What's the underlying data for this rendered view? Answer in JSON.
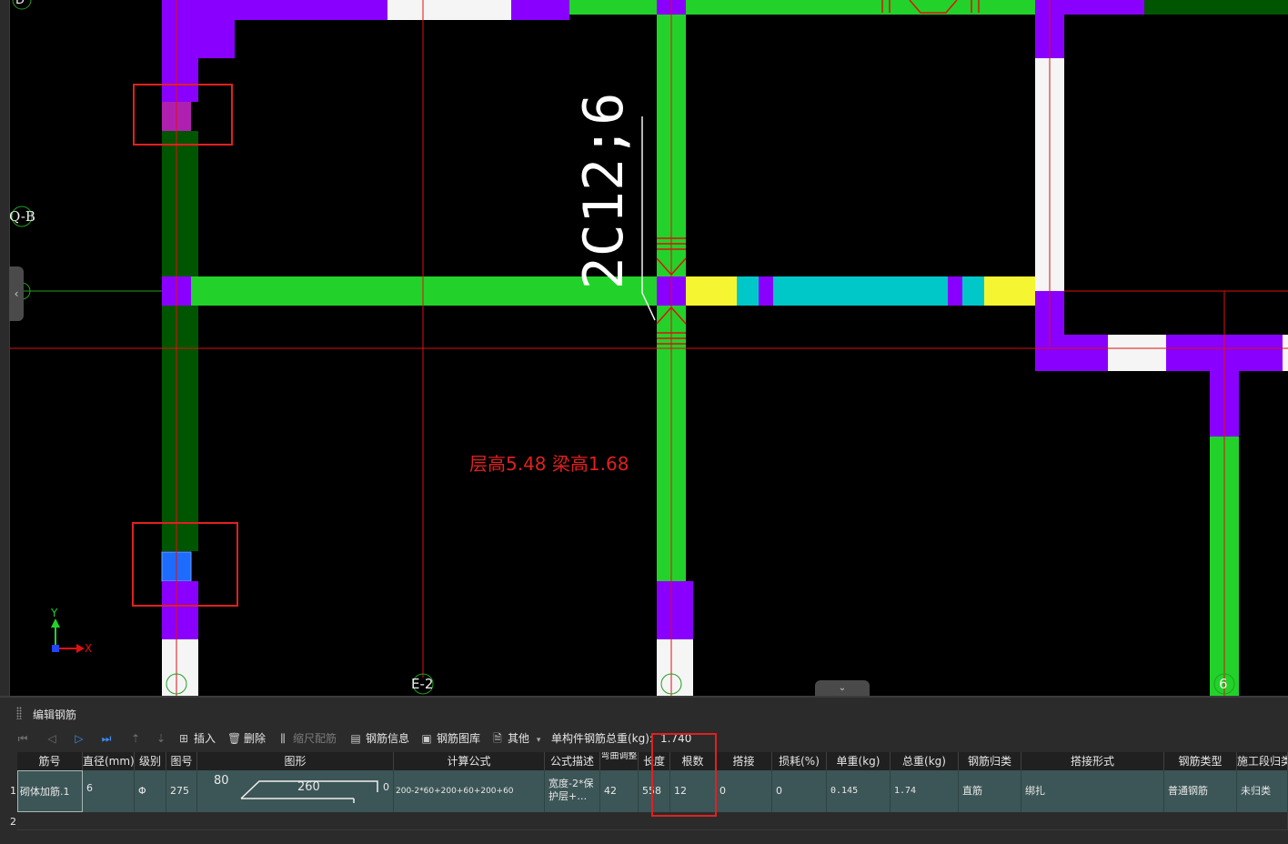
{
  "canvas": {
    "axis_labels": {
      "top_left": "D",
      "q_b": "Q-B",
      "e_2": "E-2",
      "six": "6"
    },
    "rebar_annotation": "2C12;6",
    "floor_note": "层高5.48 梁高1.68",
    "ucs": {
      "x": "X",
      "y": "Y"
    },
    "colors": {
      "purple": "#8a00ff",
      "green": "#22d22a",
      "dark_green": "#005500",
      "white": "#f5f5f5",
      "yellow": "#f5f531",
      "cyan": "#00c8c8",
      "magenta": "#b020b0",
      "blue": "#1e6bff",
      "red_line": "#e01010"
    }
  },
  "panel": {
    "title": "编辑钢筋",
    "toolbar": {
      "insert": "插入",
      "delete": "删除",
      "scale_rebar": "缩尺配筋",
      "rebar_info": "钢筋信息",
      "rebar_library": "钢筋图库",
      "other": "其他",
      "total_weight_label": "单构件钢筋总重(kg):",
      "total_weight_value": "1.740"
    },
    "columns": [
      "筋号",
      "直径(mm)",
      "级别",
      "图号",
      "图形",
      "计算公式",
      "公式描述",
      "弯曲调整",
      "长度",
      "根数",
      "搭接",
      "损耗(%)",
      "单重(kg)",
      "总重(kg)",
      "钢筋归类",
      "搭接形式",
      "钢筋类型",
      "施工段归类"
    ],
    "rows": [
      {
        "index": "1",
        "name": "砌体加筋.1",
        "diameter": "6",
        "grade": "Φ",
        "figure_no": "275",
        "shape_left": "80",
        "shape_mid": "260",
        "shape_right": "0",
        "formula": "200-2*60+200+60+200+60",
        "formula_desc": "宽度-2*保护层+…",
        "bend_adjust": "42",
        "length": "558",
        "count": "12",
        "lap": "0",
        "loss": "0",
        "unit_weight": "0.145",
        "total_weight": "1.74",
        "category": "直筋",
        "lap_type": "绑扎",
        "rebar_type": "普通钢筋",
        "construction_segment": "未归类"
      }
    ],
    "empty_row_index": "2"
  }
}
